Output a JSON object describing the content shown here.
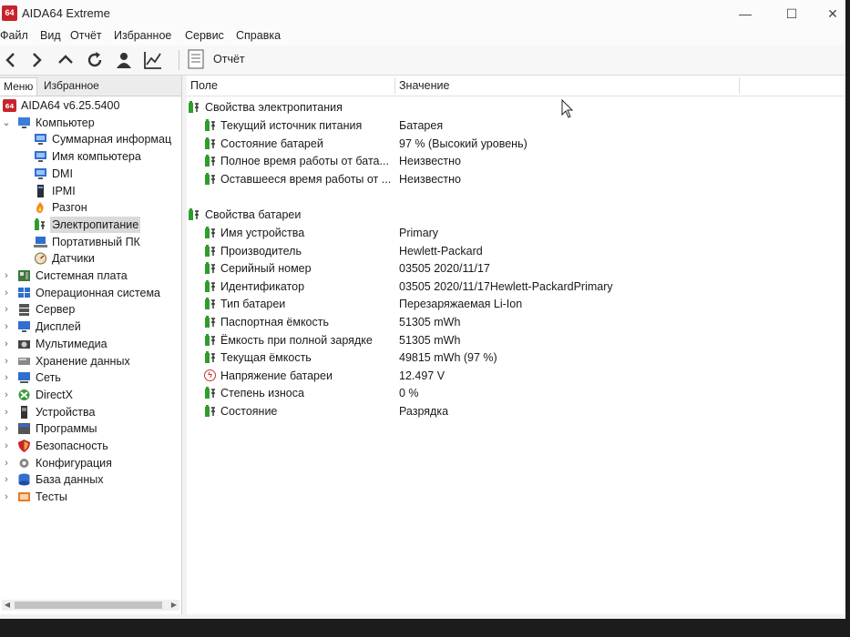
{
  "window": {
    "app_icon_text": "64",
    "title": "AIDA64 Extreme",
    "controls": {
      "minimize": "—",
      "maximize": "☐",
      "close": "✕"
    }
  },
  "menubar": [
    "Файл",
    "Вид",
    "Отчёт",
    "Избранное",
    "Сервис",
    "Справка"
  ],
  "toolbar": {
    "icons": [
      "back-icon",
      "forward-icon",
      "up-icon",
      "refresh-icon",
      "user-icon",
      "chart-icon"
    ],
    "report_label": "Отчёт"
  },
  "left_tabs": [
    "Меню",
    "Избранное"
  ],
  "tree": [
    {
      "label": "AIDA64 v6.25.5400",
      "icon": "aida64-icon",
      "level": 0,
      "expand": ""
    },
    {
      "label": "Компьютер",
      "icon": "computer-icon",
      "level": 0,
      "expand": "expanded"
    },
    {
      "label": "Суммарная информац",
      "icon": "monitor-icon",
      "level": 1,
      "expand": ""
    },
    {
      "label": "Имя компьютера",
      "icon": "monitor-icon",
      "level": 1,
      "expand": ""
    },
    {
      "label": "DMI",
      "icon": "monitor-icon",
      "level": 1,
      "expand": ""
    },
    {
      "label": "IPMI",
      "icon": "ipmi-icon",
      "level": 1,
      "expand": ""
    },
    {
      "label": "Разгон",
      "icon": "flame-icon",
      "level": 1,
      "expand": ""
    },
    {
      "label": "Электропитание",
      "icon": "battery-icon",
      "level": 1,
      "expand": "",
      "selected": true
    },
    {
      "label": "Портативный ПК",
      "icon": "laptop-icon",
      "level": 1,
      "expand": ""
    },
    {
      "label": "Датчики",
      "icon": "sensor-icon",
      "level": 1,
      "expand": ""
    },
    {
      "label": "Системная плата",
      "icon": "motherboard-icon",
      "level": 0,
      "expand": "collapsed"
    },
    {
      "label": "Операционная система",
      "icon": "windows-icon",
      "level": 0,
      "expand": "collapsed"
    },
    {
      "label": "Сервер",
      "icon": "server-icon",
      "level": 0,
      "expand": "collapsed"
    },
    {
      "label": "Дисплей",
      "icon": "display-icon",
      "level": 0,
      "expand": "collapsed"
    },
    {
      "label": "Мультимедиа",
      "icon": "multimedia-icon",
      "level": 0,
      "expand": "collapsed"
    },
    {
      "label": "Хранение данных",
      "icon": "storage-icon",
      "level": 0,
      "expand": "collapsed"
    },
    {
      "label": "Сеть",
      "icon": "network-icon",
      "level": 0,
      "expand": "collapsed"
    },
    {
      "label": "DirectX",
      "icon": "directx-icon",
      "level": 0,
      "expand": "collapsed"
    },
    {
      "label": "Устройства",
      "icon": "devices-icon",
      "level": 0,
      "expand": "collapsed"
    },
    {
      "label": "Программы",
      "icon": "programs-icon",
      "level": 0,
      "expand": "collapsed"
    },
    {
      "label": "Безопасность",
      "icon": "shield-icon",
      "level": 0,
      "expand": "collapsed"
    },
    {
      "label": "Конфигурация",
      "icon": "config-icon",
      "level": 0,
      "expand": "collapsed"
    },
    {
      "label": "База данных",
      "icon": "database-icon",
      "level": 0,
      "expand": "collapsed"
    },
    {
      "label": "Тесты",
      "icon": "tests-icon",
      "level": 0,
      "expand": "collapsed"
    }
  ],
  "columns": {
    "field": "Поле",
    "value": "Значение"
  },
  "sections": [
    {
      "title": "Свойства электропитания",
      "rows": [
        {
          "field": "Текущий источник питания",
          "value": "Батарея",
          "icon": "battery"
        },
        {
          "field": "Состояние батарей",
          "value": "97 % (Высокий уровень)",
          "icon": "battery"
        },
        {
          "field": "Полное время работы от бата...",
          "value": "Неизвестно",
          "icon": "battery"
        },
        {
          "field": "Оставшееся время работы от ...",
          "value": "Неизвестно",
          "icon": "battery"
        }
      ]
    },
    {
      "title": "Свойства батареи",
      "rows": [
        {
          "field": "Имя устройства",
          "value": "Primary",
          "icon": "battery"
        },
        {
          "field": "Производитель",
          "value": "Hewlett-Packard",
          "icon": "battery"
        },
        {
          "field": "Серийный номер",
          "value": "03505 2020/11/17",
          "icon": "battery"
        },
        {
          "field": "Идентификатор",
          "value": "03505 2020/11/17Hewlett-PackardPrimary",
          "icon": "battery"
        },
        {
          "field": "Тип батареи",
          "value": "Перезаряжаемая Li-Ion",
          "icon": "battery"
        },
        {
          "field": "Паспортная ёмкость",
          "value": "51305 mWh",
          "icon": "battery"
        },
        {
          "field": "Ёмкость при полной зарядке",
          "value": "51305 mWh",
          "icon": "battery"
        },
        {
          "field": "Текущая ёмкость",
          "value": "49815 mWh  (97 %)",
          "icon": "battery"
        },
        {
          "field": "Напряжение батареи",
          "value": "12.497 V",
          "icon": "bolt"
        },
        {
          "field": "Степень износа",
          "value": "0 %",
          "icon": "battery"
        },
        {
          "field": "Состояние",
          "value": "Разрядка",
          "icon": "battery"
        }
      ]
    }
  ],
  "colors": {
    "battery_green": "#2e9e2a",
    "selection": "#dadada",
    "aida_red": "#c8232c"
  }
}
